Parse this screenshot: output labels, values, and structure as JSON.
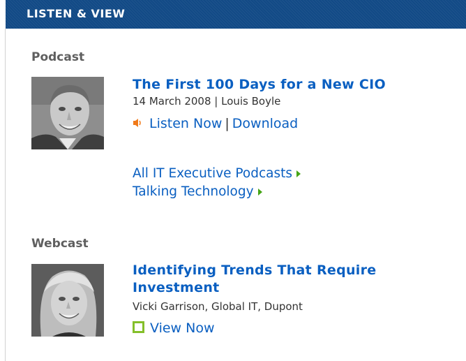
{
  "header": {
    "title": "LISTEN & VIEW"
  },
  "podcast": {
    "heading": "Podcast",
    "title": "The First 100 Days for a New CIO",
    "meta": "14 March 2008 | Louis Boyle",
    "listen_label": "Listen Now",
    "separator": "|",
    "download_label": "Download",
    "links": [
      {
        "label": "All IT Executive Podcasts"
      },
      {
        "label": "Talking Technology"
      }
    ]
  },
  "webcast": {
    "heading": "Webcast",
    "title_line1": "Identifying Trends That Require",
    "title_line2": "Investment",
    "meta": "Vicki Garrison, Global IT, Dupont",
    "view_label": "View Now"
  },
  "colors": {
    "header_bg": "#124a86",
    "link": "#0a5fc1",
    "arrow": "#46a516",
    "speaker_icon": "#f07a1a",
    "view_icon": "#84bf2a"
  },
  "icons": [
    "speaker-icon",
    "arrow-right-icon",
    "view-box-icon"
  ]
}
